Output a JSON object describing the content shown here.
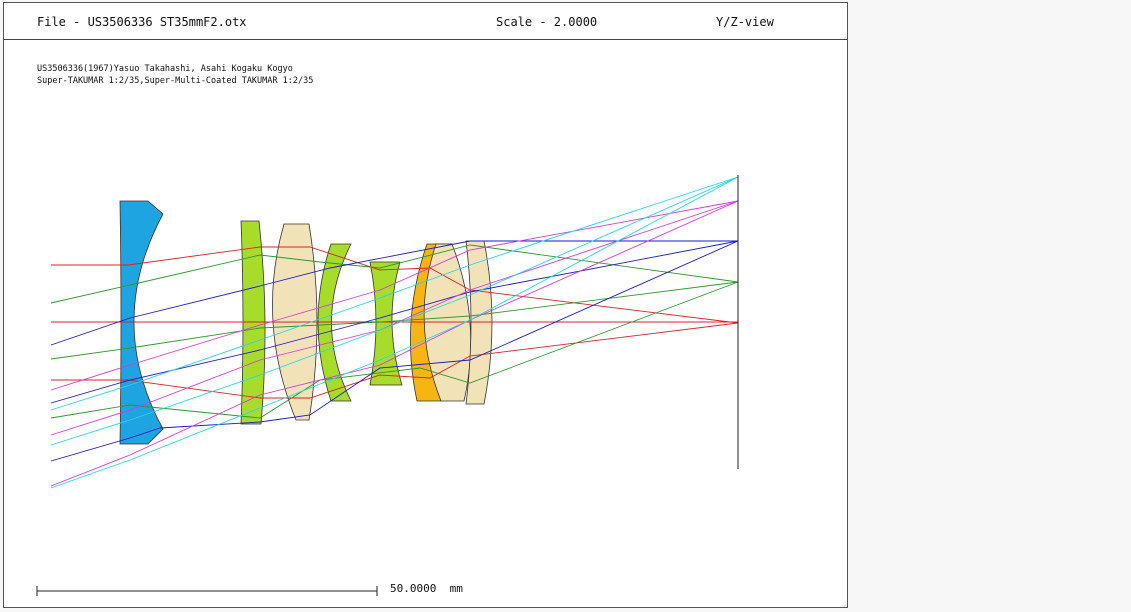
{
  "header": {
    "file_label": "File - US3506336 ST35mmF2.otx",
    "scale_label": "Scale - 2.0000",
    "view_label": "Y/Z-view"
  },
  "description": {
    "line1": "US3506336(1967)Yasuo Takahashi, Asahi Kogaku Kogyo",
    "line2": "Super-TAKUMAR 1:2/35,Super-Multi-Coated TAKUMAR 1:2/35"
  },
  "scale_bar": {
    "label": "50.0000  mm"
  },
  "colors": {
    "element_1": "#1ea4e0",
    "element_green": "#a8dc2a",
    "element_cream": "#f2e2b8",
    "element_orange": "#f7b514",
    "ray_red": "#e02020",
    "ray_green": "#2a9a2a",
    "ray_blue": "#1a1acc",
    "ray_magenta": "#d838d8",
    "ray_cyan": "#20d8e8"
  }
}
